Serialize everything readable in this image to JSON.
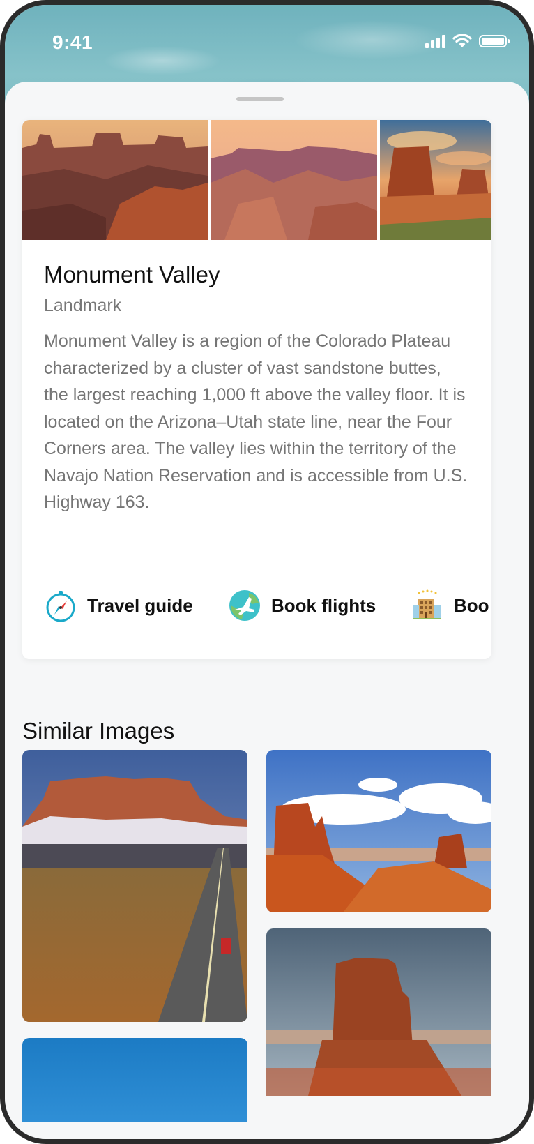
{
  "status_bar": {
    "time": "9:41",
    "signal_icon": "cellular-signal-icon",
    "wifi_icon": "wifi-icon",
    "battery_icon": "battery-icon"
  },
  "place": {
    "name": "Monument Valley",
    "category": "Landmark",
    "description": "Monument Valley is a region of the Colorado Plateau characterized by a cluster of vast sandstone buttes, the largest reaching 1,000 ft above the valley floor. It is located on the Arizona–Utah state line, near the Four Corners area. The valley lies within the territory of the Navajo Nation Reservation and is accessible from U.S. Highway 163."
  },
  "actions": [
    {
      "label": "Travel guide",
      "icon": "compass-icon"
    },
    {
      "label": "Book flights",
      "icon": "airplane-globe-icon"
    },
    {
      "label": "Boo",
      "icon": "hotel-building-icon"
    }
  ],
  "similar": {
    "title": "Similar Images"
  },
  "colors": {
    "sky": "#7bb8c1",
    "text_primary": "#111111",
    "text_secondary": "#757575",
    "rock": "#c4552b"
  }
}
